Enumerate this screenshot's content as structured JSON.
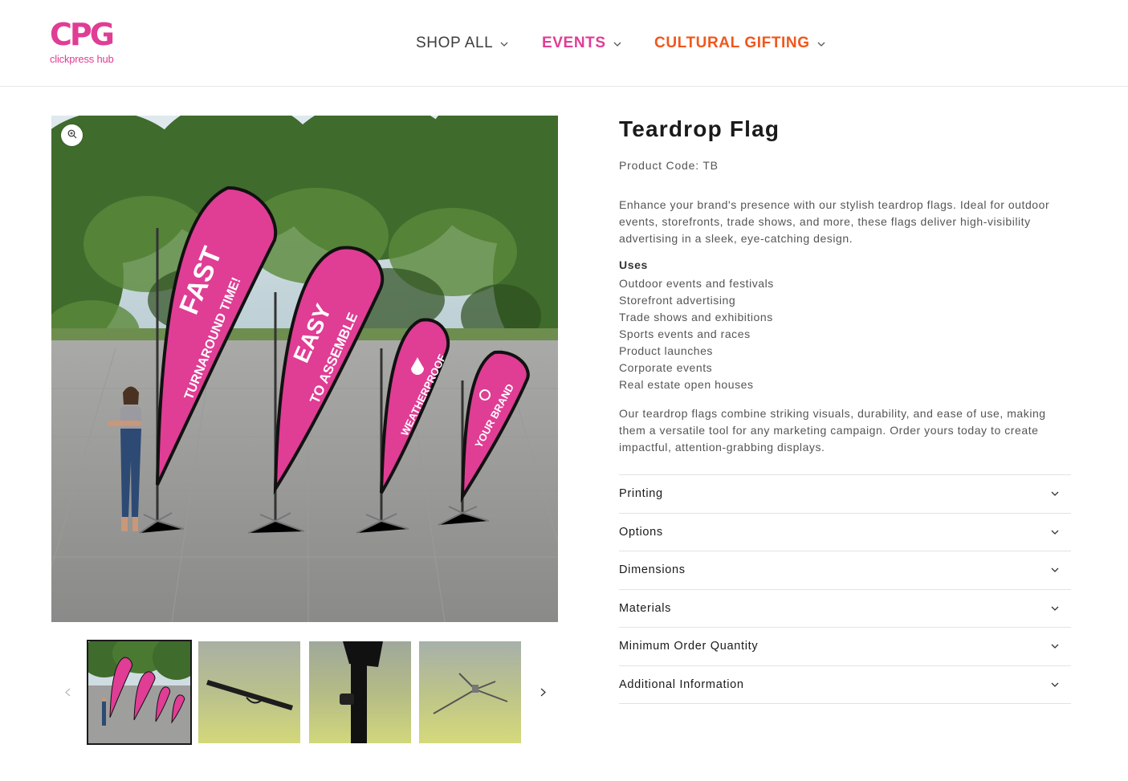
{
  "brand": {
    "logo_text": "CPG",
    "logo_subtitle": "clickpress hub",
    "colors": {
      "pink": "#e03d95",
      "orange": "#f0571d"
    }
  },
  "nav": {
    "items": [
      {
        "label": "SHOP ALL",
        "icon": "chevron-down-icon"
      },
      {
        "label": "EVENTS",
        "icon": "chevron-down-icon",
        "color": "#e03d95"
      },
      {
        "label": "CULTURAL GIFTING",
        "icon": "chevron-down-icon",
        "color": "#f0571d"
      }
    ]
  },
  "product": {
    "title": "Teardrop Flag",
    "code": "Product Code: TB",
    "description": "Enhance your brand's presence with our stylish teardrop flags. Ideal for outdoor events, storefronts, trade shows, and more, these flags deliver high-visibility advertising in a sleek, eye-catching design.",
    "uses_title": "Uses",
    "uses": [
      "Outdoor events and festivals",
      "Storefront advertising",
      "Trade shows and exhibitions",
      "Sports events and races",
      "Product launches",
      "Corporate events",
      "Real estate open houses"
    ],
    "closing": "Our teardrop flags combine striking visuals, durability, and ease of use, making them a versatile tool for any marketing campaign. Order yours today to create impactful, attention-grabbing displays."
  },
  "image": {
    "flags": [
      {
        "line1": "FAST",
        "line2": "TURNAROUND TIME!"
      },
      {
        "line1": "EASY",
        "line2": "TO ASSEMBLE"
      },
      {
        "line1": "",
        "line2": "WEATHERPROOF"
      },
      {
        "line1": "",
        "line2": "YOUR BRAND"
      }
    ],
    "zoom_icon": "zoom-in-icon"
  },
  "accordion": [
    {
      "label": "Printing"
    },
    {
      "label": "Options"
    },
    {
      "label": "Dimensions"
    },
    {
      "label": "Materials"
    },
    {
      "label": "Minimum Order Quantity"
    },
    {
      "label": "Additional Information"
    }
  ],
  "thumbnails": {
    "prev_icon": "chevron-left-icon",
    "next_icon": "chevron-right-icon",
    "items": [
      "flags-scene",
      "carry-bag",
      "pole-clamp",
      "cross-base"
    ]
  }
}
